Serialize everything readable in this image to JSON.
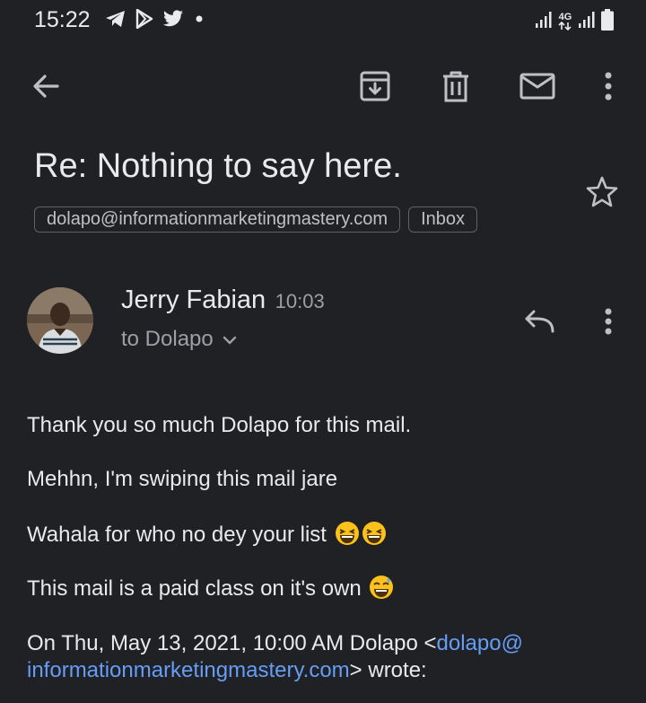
{
  "status_bar": {
    "time": "15:22",
    "left_icons": [
      "telegram-icon",
      "play-store-icon",
      "twitter-icon",
      "notification-dot-icon"
    ],
    "network_label": "4G",
    "right_icons": [
      "signal-icon",
      "network-4g-icon",
      "signal-icon",
      "battery-icon"
    ]
  },
  "toolbar": {
    "icons": [
      "back-arrow-icon",
      "archive-icon",
      "trash-icon",
      "mark-unread-icon",
      "more-vert-icon"
    ]
  },
  "email": {
    "subject": "Re: Nothing to say here.",
    "labels": [
      "dolapo@informationmarketingmastery.com",
      "Inbox"
    ],
    "sender_name": "Jerry Fabian",
    "time": "10:03",
    "recipient": "to Dolapo",
    "body": {
      "line1": "Thank you so much Dolapo for this mail.",
      "line2": "Mehhn, I'm swiping this mail jare",
      "line3": "Wahala for who no dey your list",
      "line4": "This mail is a paid class on it's own",
      "quote_prefix": "On Thu, May 13, 2021, 10:00 AM Dolapo <",
      "quote_link": "dolapo@ informationmarketingmastery.com",
      "quote_suffix": "> wrote:"
    }
  },
  "colors": {
    "background": "#202124",
    "text": "#e8eaed",
    "secondary_text": "#9aa0a6",
    "link": "#669df6",
    "icon": "#bdc1c6"
  }
}
